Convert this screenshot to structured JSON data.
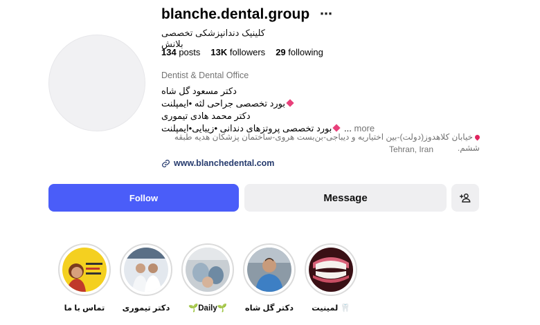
{
  "profile": {
    "username": "blanche.dental.group",
    "options_icon": "more-horizontal-icon",
    "full_name": "کلینیک دندانپزشکی تخصصی بلانش",
    "stats": {
      "posts_count": "134",
      "posts_label": "posts",
      "followers_count": "13K",
      "followers_label": "followers",
      "following_count": "29",
      "following_label": "following"
    },
    "category": "Dentist & Dental Office",
    "bio_lines": [
      "دکتر مسعود گل شاه",
      "بورد تخصصی جراحی لثه •ایمپلنت",
      "دکتر محمد هادی تیموری",
      "بورد تخصصی پروتزهای دندانی •زیبایی•ایمپلنت"
    ],
    "bio_ellipsis": "...",
    "more_label": "more",
    "address": "خیابان کلاهدوز(دولت)-بین اختیاریه و دیباجی-بن‌بست هروی-ساختمان پزشکان هدیه طبقه ششم.",
    "city": "Tehran, Iran",
    "website": "www.blanchedental.com"
  },
  "actions": {
    "follow_label": "Follow",
    "message_label": "Message",
    "add_user_icon": "add-user-icon"
  },
  "highlights": [
    {
      "label": "لمینیت 🦷"
    },
    {
      "label": "دکتر گل شاه"
    },
    {
      "label": "🌱Daily🌱"
    },
    {
      "label": "دکتر تیموری"
    },
    {
      "label": "تماس با ما"
    }
  ],
  "colors": {
    "follow_button": "#4a5df9",
    "message_button": "#efeff1",
    "link": "#263b6e",
    "muted_text": "#737373",
    "accent_diamond": "#e8407a"
  }
}
